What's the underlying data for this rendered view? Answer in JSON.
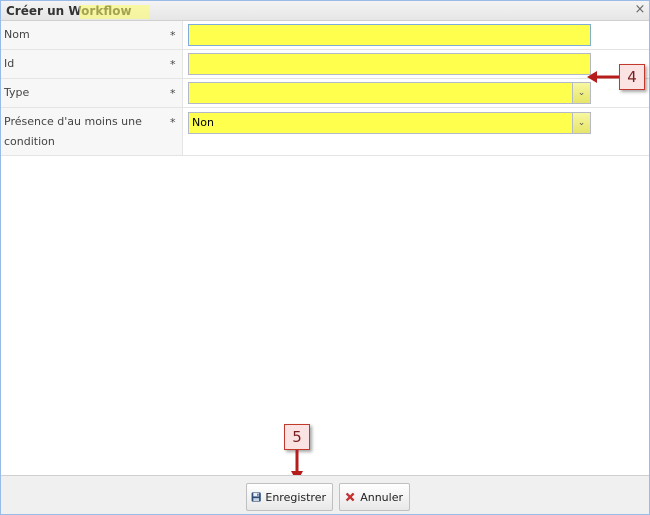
{
  "dialog": {
    "title": "Créer un Workflow",
    "close_glyph": "×"
  },
  "form": {
    "fields": [
      {
        "label": "Nom",
        "required_mark": "*",
        "value": "",
        "kind": "text"
      },
      {
        "label": "Id",
        "required_mark": "*",
        "value": "",
        "kind": "text"
      },
      {
        "label": "Type",
        "required_mark": "*",
        "value": "",
        "kind": "combo"
      },
      {
        "label": "Présence d'au moins une condition",
        "required_mark": "*",
        "value": "Non",
        "kind": "combo"
      }
    ],
    "combo_trigger_glyph": "⌄"
  },
  "callouts": {
    "step4": "4",
    "step5": "5"
  },
  "footer": {
    "save_label": "Enregistrer",
    "cancel_label": "Annuler"
  },
  "colors": {
    "highlight": "#ffff4d",
    "callout_border": "#c0392b",
    "arrow": "#b71c1c",
    "border_accent": "#99bbe8"
  }
}
